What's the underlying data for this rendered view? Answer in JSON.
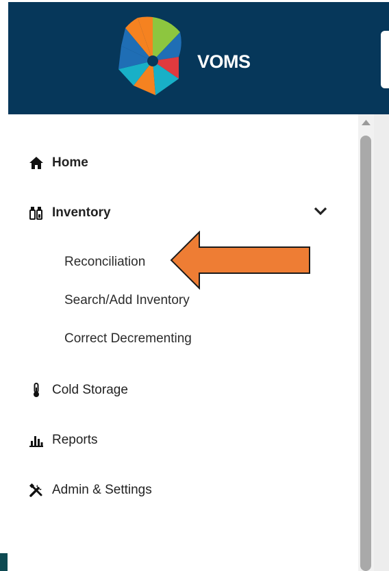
{
  "header": {
    "brand": "VOMS",
    "colors": {
      "background": "#06375a"
    }
  },
  "sidebar": {
    "items": [
      {
        "label": "Home",
        "icon": "home-icon"
      },
      {
        "label": "Inventory",
        "icon": "vaccine-vials-icon",
        "expanded": true,
        "children": [
          {
            "label": "Reconciliation"
          },
          {
            "label": "Search/Add Inventory"
          },
          {
            "label": "Correct Decrementing"
          }
        ]
      },
      {
        "label": "Cold Storage",
        "icon": "thermometer-icon"
      },
      {
        "label": "Reports",
        "icon": "bar-chart-icon"
      },
      {
        "label": "Admin & Settings",
        "icon": "tools-icon"
      }
    ]
  },
  "annotation": {
    "arrow_color": "#ee7d34",
    "points_to": "Reconciliation"
  }
}
